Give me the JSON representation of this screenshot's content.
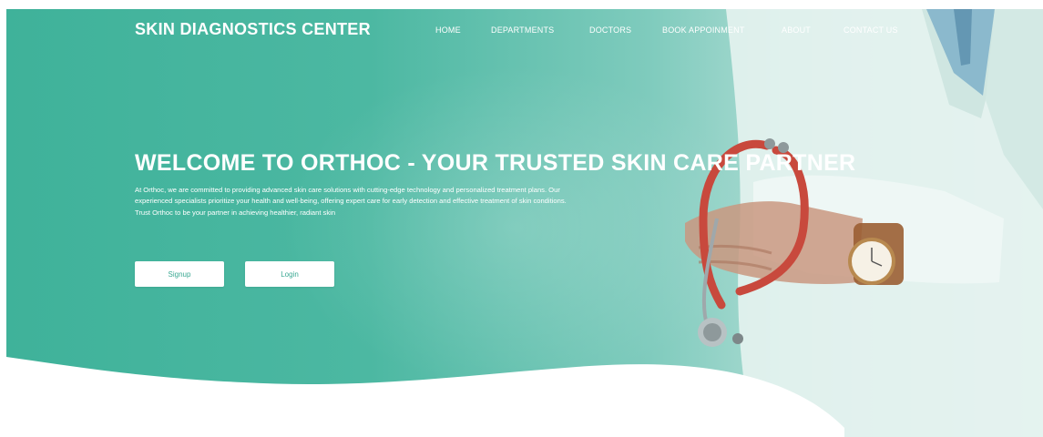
{
  "brand": "SKIN DIAGNOSTICS CENTER",
  "nav": [
    {
      "label": "HOME"
    },
    {
      "label": "DEPARTMENTS"
    },
    {
      "label": "DOCTORS"
    },
    {
      "label": "BOOK APPOINMENT"
    },
    {
      "label": "ABOUT"
    },
    {
      "label": "CONTACT US"
    }
  ],
  "hero": {
    "headline": "WELCOME TO ORTHOC - YOUR TRUSTED SKIN CARE PARTNER",
    "lead": "At Orthoc, we are committed to providing advanced skin care solutions with cutting-edge technology and personalized treatment plans. Our experienced specialists prioritize your health and well-being, offering expert care for early detection and effective treatment of skin conditions. Trust Orthoc to be your partner in achieving healthier, radiant skin",
    "signup_label": "Signup",
    "login_label": "Login"
  },
  "colors": {
    "accent": "#3fb29a",
    "button_bg": "#ffffff",
    "button_text": "#3aa892",
    "text_on_hero": "#ffffff"
  }
}
